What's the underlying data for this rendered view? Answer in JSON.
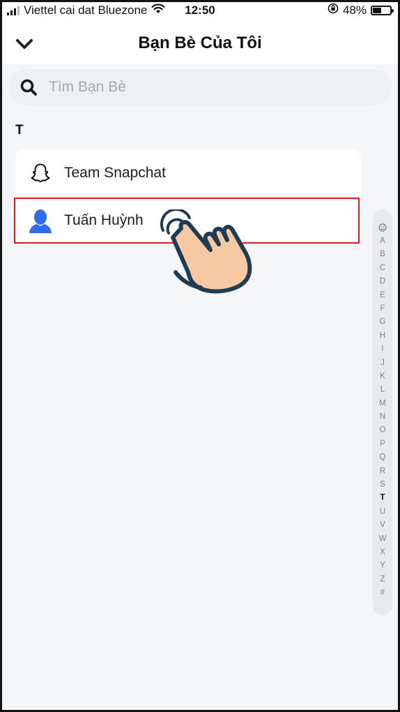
{
  "status": {
    "carrier": "Viettel cai dat Bluezone",
    "time": "12:50",
    "battery": "48%",
    "battery_level": 0.48
  },
  "header": {
    "title": "Bạn Bè Của Tôi",
    "back_icon": "chevron-down-icon"
  },
  "search": {
    "placeholder": "Tìm Bạn Bè",
    "icon": "search-icon"
  },
  "section": {
    "letter": "T"
  },
  "friends": [
    {
      "name": "Team Snapchat",
      "icon": "snapchat-ghost-icon"
    },
    {
      "name": "Tuấn Huỳnh",
      "icon": "avatar-icon"
    }
  ],
  "alphabet_index": {
    "top_icon": "smiley-icon",
    "letters": [
      "A",
      "B",
      "C",
      "D",
      "E",
      "F",
      "G",
      "H",
      "I",
      "J",
      "K",
      "L",
      "M",
      "N",
      "O",
      "P",
      "Q",
      "R",
      "S",
      "T",
      "U",
      "V",
      "W",
      "X",
      "Y",
      "Z",
      "#"
    ],
    "active": "T"
  },
  "colors": {
    "highlight": "#d7191f",
    "avatar": "#2f6cf0",
    "hand_skin": "#f6c9a2",
    "hand_outline": "#1f3b55"
  }
}
